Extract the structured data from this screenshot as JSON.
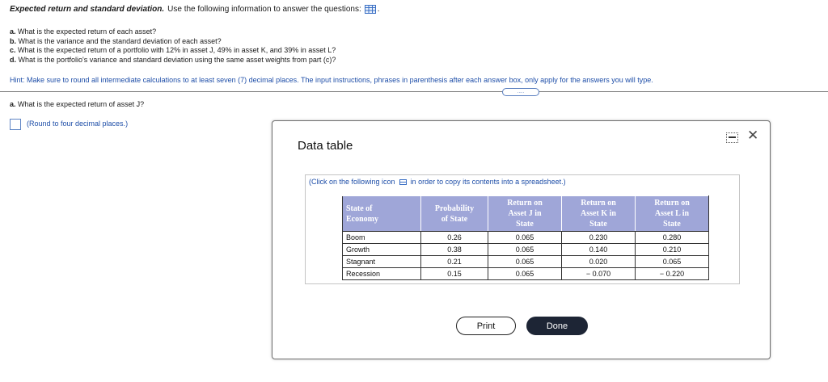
{
  "header": {
    "title_bold": "Expected return and standard deviation.",
    "title_rest": "Use the following information to answer the questions:",
    "title_end": ".",
    "grid_icon": "table-grid-icon"
  },
  "questions": [
    {
      "letter": "a.",
      "text": "What is the expected return of each asset?"
    },
    {
      "letter": "b.",
      "text": "What is the variance and the standard deviation of each asset?"
    },
    {
      "letter": "c.",
      "text": "What is the expected return of a portfolio with 12% in asset J, 49% in asset K, and 39% in asset L?"
    },
    {
      "letter": "d.",
      "text": "What is the portfolio's variance and standard deviation using the same asset weights from part (c)?"
    }
  ],
  "hint": "Hint: Make sure to round all intermediate calculations to at least seven (7) decimal places. The input instructions, phrases in parenthesis after each answer box, only apply for the answers you will type.",
  "divider_handle": ".....",
  "current_question": {
    "letter": "a.",
    "text": "What is the expected return of asset J?"
  },
  "answer": {
    "value": "",
    "note": "(Round to four decimal places.)"
  },
  "modal": {
    "title": "Data table",
    "copy_note_before": "(Click on the following icon",
    "copy_note_after": "in order to copy its contents into a spreadsheet.)",
    "headers": [
      [
        "State of",
        "Economy"
      ],
      [
        "Probability",
        "of State"
      ],
      [
        "Return on",
        "Asset J in",
        "State"
      ],
      [
        "Return on",
        "Asset K in",
        "State"
      ],
      [
        "Return on",
        "Asset L in",
        "State"
      ]
    ],
    "rows": [
      [
        "Boom",
        "0.26",
        "0.065",
        "0.230",
        "0.280"
      ],
      [
        "Growth",
        "0.38",
        "0.065",
        "0.140",
        "0.210"
      ],
      [
        "Stagnant",
        "0.21",
        "0.065",
        "0.020",
        "0.065"
      ],
      [
        "Recession",
        "0.15",
        "0.065",
        "− 0.070",
        "− 0.220"
      ]
    ],
    "print_label": "Print",
    "done_label": "Done"
  },
  "colors": {
    "header_bg": "#9fa6d8",
    "link_blue": "#1e4ea8",
    "done_bg": "#1d2535"
  }
}
